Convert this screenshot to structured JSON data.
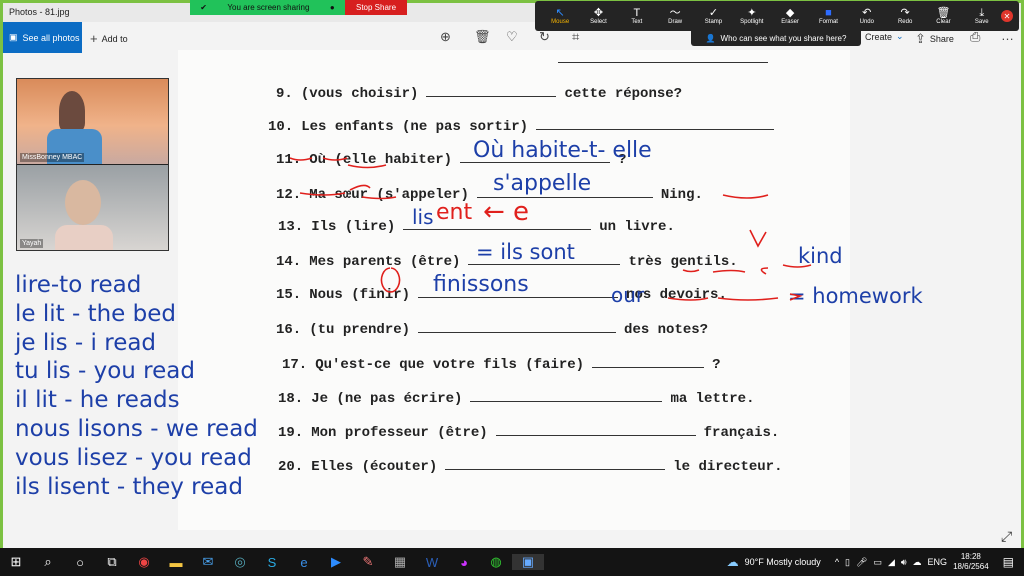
{
  "window": {
    "title": "Photos - 81.jpg"
  },
  "toolbar": {
    "see_all": "See all photos",
    "add_to": "Add to",
    "create": "Create",
    "share": "Share"
  },
  "sharing": {
    "status": "You are screen sharing",
    "stop": "Stop Share",
    "who": "Who can see what you share here?"
  },
  "annotate": [
    {
      "label": "Mouse",
      "icon": "mouse-icon"
    },
    {
      "label": "Select",
      "icon": "select-icon"
    },
    {
      "label": "Text",
      "icon": "text-icon"
    },
    {
      "label": "Draw",
      "icon": "draw-icon"
    },
    {
      "label": "Stamp",
      "icon": "stamp-icon"
    },
    {
      "label": "Spotlight",
      "icon": "spotlight-icon"
    },
    {
      "label": "Eraser",
      "icon": "eraser-icon"
    },
    {
      "label": "Format",
      "icon": "format-icon"
    },
    {
      "label": "Undo",
      "icon": "undo-icon"
    },
    {
      "label": "Redo",
      "icon": "redo-icon"
    },
    {
      "label": "Clear",
      "icon": "trash-icon"
    },
    {
      "label": "Save",
      "icon": "save-icon"
    }
  ],
  "participants": [
    {
      "name": "MissBonney MBAC"
    },
    {
      "name": "Yayah"
    }
  ],
  "worksheet": [
    {
      "num": "9.",
      "pre": "(vous choisir)",
      "post": "cette réponse?"
    },
    {
      "num": "10.",
      "pre": "Les enfants (ne pas sortir)",
      "post": ""
    },
    {
      "num": "11.",
      "pre": "Où (elle habiter)",
      "post": "?"
    },
    {
      "num": "12.",
      "pre": "Ma sœur (s'appeler)",
      "post": "Ning."
    },
    {
      "num": "13.",
      "pre": "Ils (lire)",
      "post": "un livre."
    },
    {
      "num": "14.",
      "pre": "Mes parents (être)",
      "post": "très gentils."
    },
    {
      "num": "15.",
      "pre": "Nous (finir)",
      "post": "nos devoirs."
    },
    {
      "num": "16.",
      "pre": "(tu prendre)",
      "post": "des notes?"
    },
    {
      "num": "17.",
      "pre": "Qu'est-ce que votre fils (faire)",
      "post": "?"
    },
    {
      "num": "18.",
      "pre": "Je (ne pas écrire)",
      "post": "ma lettre."
    },
    {
      "num": "19.",
      "pre": "Mon professeur (être)",
      "post": "français."
    },
    {
      "num": "20.",
      "pre": "Elles (écouter)",
      "post": "le directeur."
    }
  ],
  "handwriting": {
    "a11": "Où habite-t- elle",
    "a12": "s'appelle",
    "a13": "lis",
    "a13red": "ent",
    "a13arrow": "← e",
    "a14": "= ils sont",
    "kind": "kind",
    "a15": "finissons",
    "our": "our",
    "homework": "= homework"
  },
  "notes": [
    "lire-to read",
    "le lit - the bed",
    "je lis - i read",
    "tu lis - you read",
    "il lit - he reads",
    "nous lisons - we read",
    "vous lisez - you read",
    "ils lisent - they read"
  ],
  "taskbar": {
    "weather": "90°F  Mostly cloudy",
    "lang": "ENG",
    "time": "18:28",
    "date": "18/6/2564"
  },
  "colors": {
    "ink_blue": "#1d3fa8",
    "ink_red": "#e0201c",
    "share_green": "#21c25a",
    "border_green": "#7cc142"
  }
}
